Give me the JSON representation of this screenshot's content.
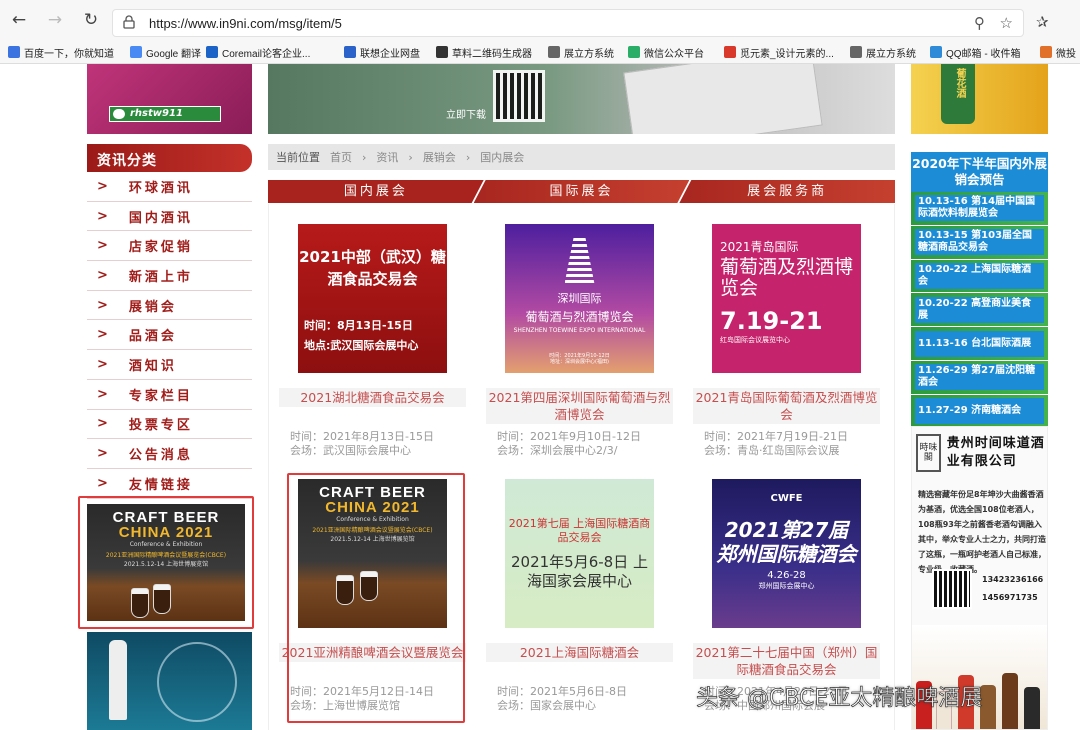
{
  "browser": {
    "url": "https://www.in9ni.com/msg/item/5",
    "nav": {
      "back": "←",
      "forward": "→",
      "reload": "↻"
    },
    "bookmarks": [
      {
        "label": "百度一下，你就知道",
        "color": "#3b73e0"
      },
      {
        "label": "Google 翻译",
        "color": "#4a8af4"
      },
      {
        "label": "Coremail论客企业...",
        "color": "#1c63c7"
      },
      {
        "label": "联想企业网盘",
        "color": "#2a62c9"
      },
      {
        "label": "草料二维码生成器",
        "color": "#333333"
      },
      {
        "label": "展立方系统",
        "color": "#666666"
      },
      {
        "label": "微信公众平台",
        "color": "#2aae67"
      },
      {
        "label": "觅元素_设计元素的...",
        "color": "#d9392b"
      },
      {
        "label": "展立方系统",
        "color": "#666666"
      },
      {
        "label": "QQ邮箱 - 收件箱",
        "color": "#2f8bd8"
      },
      {
        "label": "微投",
        "color": "#e0702a"
      }
    ]
  },
  "left_banner": {
    "wechat_id": "rhstw911"
  },
  "top_banner": {
    "caption": "立即下载"
  },
  "right_banner": {
    "jar_text": "葡花酒"
  },
  "sidebar": {
    "title": "资讯分类",
    "items": [
      "环球酒讯",
      "国内酒讯",
      "店家促销",
      "新酒上市",
      "展销会",
      "品酒会",
      "酒知识",
      "专家栏目",
      "投票专区",
      "公告消息",
      "友情链接"
    ]
  },
  "craft_ad": {
    "line1": "CRAFT BEER",
    "line2": "CHINA 2021",
    "line3": "Conference & Exhibition",
    "line4": "2021亚洲国际精酿啤酒会议暨展览会(CBCE)",
    "line5": "2021.5.12-14  上海世博展览馆"
  },
  "breadcrumb": {
    "label": "当前位置",
    "items": [
      "首页",
      "资讯",
      "展销会",
      "国内展会"
    ]
  },
  "tabs": [
    "国内展会",
    "国际展会",
    "展会服务商"
  ],
  "cards": [
    {
      "title": "2021湖北糖酒食品交易会",
      "time": "时间：2021年8月13日-15日",
      "venue": "会场：武汉国际会展中心",
      "thumb": {
        "a": "2021中部（武汉）糖酒食品交易会",
        "b1": "时间：8月13日-15日",
        "b2": "地点:武汉国际会展中心"
      }
    },
    {
      "title": "2021第四届深圳国际葡萄酒与烈酒博览会",
      "time": "时间：2021年9月10日-12日",
      "venue": "会场：深圳会展中心2/3/",
      "thumb": {
        "a": "深圳国际",
        "b": "葡萄酒与烈酒博览会",
        "c": "SHENZHEN TOEWINE EXPO INTERNATIONAL",
        "d1": "时间：2021年9月10-12日",
        "d2": "地址：深圳会展中心(福田)"
      }
    },
    {
      "title": "2021青岛国际葡萄酒及烈酒博览会",
      "time": "时间：2021年7月19日-21日",
      "venue": "会场：青岛·红岛国际会议展",
      "thumb": {
        "a": "2021青岛国际",
        "b": "葡萄酒及烈酒博览会",
        "c": "7.19-21",
        "d": "红岛国际会议展览中心"
      }
    },
    {
      "title": "2021亚洲精酿啤酒会议暨展览会",
      "time": "时间：2021年5月12日-14日",
      "venue": "会场：上海世博展览馆",
      "thumb": {
        "a": "CRAFT BEER",
        "b": "CHINA 2021",
        "c": "Conference & Exhibition",
        "d": "2021亚洲国际精酿啤酒会议暨展览会(CBCE)",
        "e": "2021.5.12-14  上海世博展览馆"
      }
    },
    {
      "title": "2021上海国际糖酒会",
      "time": "时间：2021年5月6日-8日",
      "venue": "会场：国家会展中心",
      "thumb": {
        "a": "2021第七届 上海国际糖酒商品交易会",
        "b": "2021年5月6-8日 上海国家会展中心"
      }
    },
    {
      "title": "2021第二十七届中国（郑州）国际糖酒食品交易会",
      "time": "时间：2021年4月26日-28日",
      "venue": "会场：中国郑州国际会展",
      "thumb": {
        "logo": "CWFE",
        "a": "2021第27届 郑州国际糖酒会",
        "b": "4.26-28",
        "c": "郑州国际会展中心"
      }
    }
  ],
  "right_sidebar": {
    "title": "2020年下半年国内外展销会预告",
    "events": [
      "10.13-16 第14届中国国际酒饮料制展览会",
      "10.13-15 第103届全国糖酒商品交易会",
      "10.20-22 上海国际糖酒会",
      "10.20-22 高登商业美食展",
      "11.13-16 台北国际酒展",
      "11.26-29 第27届沈阳糖酒会",
      "11.27-29 济南糖酒会"
    ],
    "winery": {
      "seal": "時味閣",
      "name": "贵州时间味道酒业有限公司",
      "desc": "精选窖藏年份足8年坤沙大曲酱香酒为基酒，优选全国108位老酒人，108瓶93年之前酱香老酒勾调融入其中，举众专业人士之力，共同打造了这瓶，一瓶呵护老酒人自己标准，专业级，收藏酒。",
      "phone1": "13423236166",
      "phone2": "1456971735"
    }
  },
  "watermark": "头条 @CBCE亚太精酿啤酒展"
}
